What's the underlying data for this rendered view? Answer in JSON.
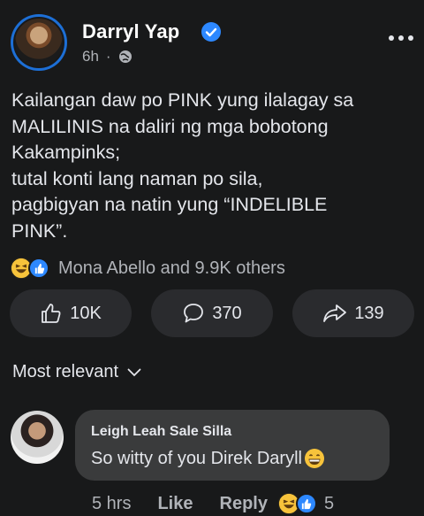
{
  "post": {
    "author": "Darryl Yap",
    "time": "6h",
    "separator": "·",
    "lines": [
      "Kailangan daw po PINK yung ilalagay sa",
      "MALILINIS na daliri ng mga bobotong",
      "Kakampinks;",
      "tutal konti lang naman po sila,",
      "pagbigyan na natin yung “INDELIBLE",
      "PINK”."
    ],
    "reactions_text": "Mona Abello and 9.9K others"
  },
  "actions": {
    "like_count": "10K",
    "comment_count": "370",
    "share_count": "139"
  },
  "comments": {
    "sort_label": "Most relevant",
    "items": [
      {
        "author": "Leigh Leah Sale Silla",
        "text": "So witty of you Direk Daryll",
        "time": "5 hrs",
        "like_label": "Like",
        "reply_label": "Reply",
        "reaction_count": "5"
      }
    ]
  },
  "colors": {
    "background": "#18191a",
    "verified": "#2d88ff",
    "bubble": "#3a3b3c"
  },
  "icons": [
    "verified-icon",
    "globe-icon",
    "more-icon",
    "haha-icon",
    "like-icon",
    "thumbs-up-icon",
    "comment-icon",
    "share-icon",
    "chevron-down-icon",
    "grin-emoji-icon"
  ]
}
